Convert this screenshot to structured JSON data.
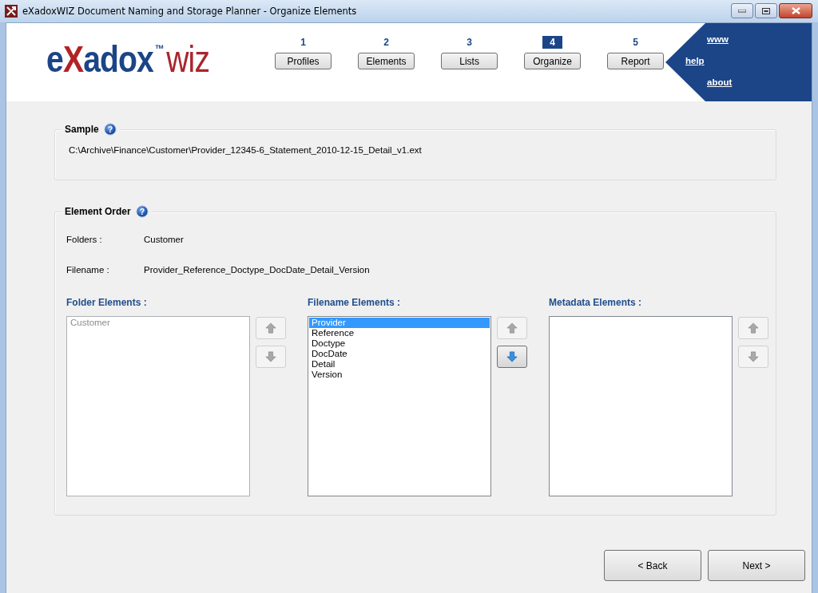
{
  "window": {
    "title": "eXadoxWIZ Document Naming and Storage Planner - Organize Elements"
  },
  "logo": {
    "prefix": "e",
    "accent": "X",
    "rest": "adox",
    "trademark": "™",
    "product": "wiz"
  },
  "steps": [
    {
      "number": "1",
      "label": "Profiles",
      "selected": false
    },
    {
      "number": "2",
      "label": "Elements",
      "selected": false
    },
    {
      "number": "3",
      "label": "Lists",
      "selected": false
    },
    {
      "number": "4",
      "label": "Organize",
      "selected": true
    },
    {
      "number": "5",
      "label": "Report",
      "selected": false
    }
  ],
  "links": [
    "www",
    "help",
    "about"
  ],
  "sample": {
    "title": "Sample",
    "help": "?",
    "path": "C:\\Archive\\Finance\\Customer\\Provider_12345-6_Statement_2010-12-15_Detail_v1.ext"
  },
  "element_order": {
    "title": "Element Order",
    "help": "?",
    "folders_label": "Folders :",
    "folders_value": "Customer",
    "filename_label": "Filename :",
    "filename_value": "Provider_Reference_Doctype_DocDate_Detail_Version"
  },
  "lists": [
    {
      "title": "Folder Elements :",
      "disabled": true,
      "up_disabled": true,
      "down_disabled": true,
      "items": [
        {
          "label": "Customer",
          "selected": false
        }
      ]
    },
    {
      "title": "Filename Elements :",
      "disabled": false,
      "up_disabled": true,
      "down_disabled": false,
      "items": [
        {
          "label": "Provider",
          "selected": true
        },
        {
          "label": "Reference",
          "selected": false
        },
        {
          "label": "Doctype",
          "selected": false
        },
        {
          "label": "DocDate",
          "selected": false
        },
        {
          "label": "Detail",
          "selected": false
        },
        {
          "label": "Version",
          "selected": false
        }
      ]
    },
    {
      "title": "Metadata Elements :",
      "disabled": false,
      "up_disabled": true,
      "down_disabled": true
    }
  ],
  "buttons": [
    "< Back",
    "Next >"
  ]
}
